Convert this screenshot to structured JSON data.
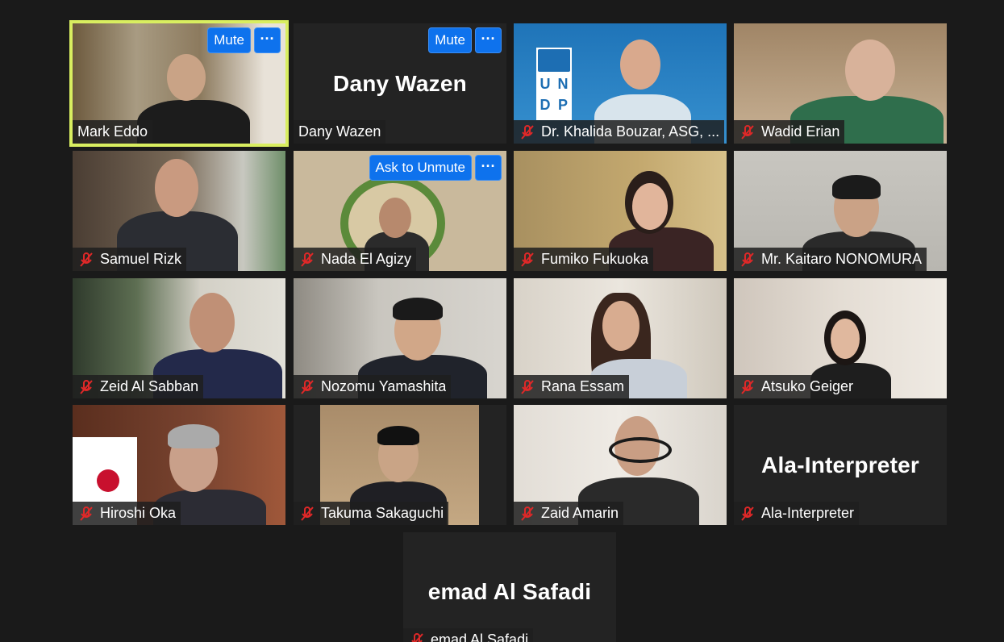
{
  "meeting": {
    "tiles": [
      {
        "name": "Mark Eddo",
        "active": true,
        "mute_button": "Mute",
        "muted": false
      },
      {
        "name": "Dany Wazen",
        "big_name": "Dany Wazen",
        "mute_button": "Mute",
        "muted": false
      },
      {
        "name": "Dr. Khalida Bouzar, ASG, ...",
        "muted": true,
        "logo_text": [
          "U",
          "N",
          "D",
          "P"
        ]
      },
      {
        "name": "Wadid Erian",
        "muted": true
      },
      {
        "name": "Samuel Rizk",
        "muted": true
      },
      {
        "name": "Nada El Agizy",
        "muted": true,
        "ask_button": "Ask to Unmute"
      },
      {
        "name": "Fumiko Fukuoka",
        "muted": true
      },
      {
        "name": "Mr. Kaitaro NONOMURA",
        "muted": true
      },
      {
        "name": "Zeid Al Sabban",
        "muted": true
      },
      {
        "name": "Nozomu Yamashita",
        "muted": true
      },
      {
        "name": "Rana Essam",
        "muted": true
      },
      {
        "name": "Atsuko Geiger",
        "muted": true
      },
      {
        "name": "Hiroshi Oka",
        "muted": true
      },
      {
        "name": "Takuma Sakaguchi",
        "muted": true
      },
      {
        "name": "Zaid Amarin",
        "muted": true
      },
      {
        "name": "Ala-Interpreter",
        "big_name": "Ala-Interpreter",
        "muted": true
      },
      {
        "name": "emad Al Safadi",
        "big_name": "emad Al Safadi",
        "muted": true
      }
    ],
    "more_label": "···"
  }
}
